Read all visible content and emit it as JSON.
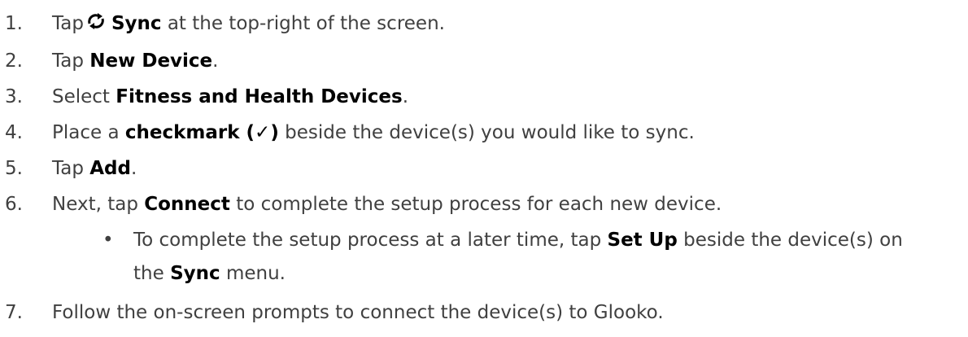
{
  "steps": [
    {
      "num": "1.",
      "pre": "Tap",
      "icon": "sync-icon",
      "bold": "Sync",
      "post": " at the top-right of the screen."
    },
    {
      "num": "2.",
      "pre": "Tap ",
      "bold": "New Device",
      "post": "."
    },
    {
      "num": "3.",
      "pre": "Select ",
      "bold": "Fitness and Health Devices",
      "post": "."
    },
    {
      "num": "4.",
      "pre": "Place a ",
      "bold": "checkmark (✓)",
      "post": " beside the device(s) you would like to sync."
    },
    {
      "num": "5.",
      "pre": "Tap ",
      "bold": "Add",
      "post": "."
    },
    {
      "num": "6.",
      "pre": "Next, tap ",
      "bold": "Connect",
      "post": " to complete the setup process for each new device."
    },
    {
      "num": "7.",
      "text": "Follow the on-screen prompts to connect the device(s) to Glooko."
    }
  ],
  "sub_bullet": {
    "bullet": "•",
    "line1_pre": "To complete the setup process at a later time, tap ",
    "line1_bold": "Set Up",
    "line1_post": " beside the device(s) on",
    "line2_pre": "the ",
    "line2_bold": "Sync",
    "line2_post": " menu."
  }
}
